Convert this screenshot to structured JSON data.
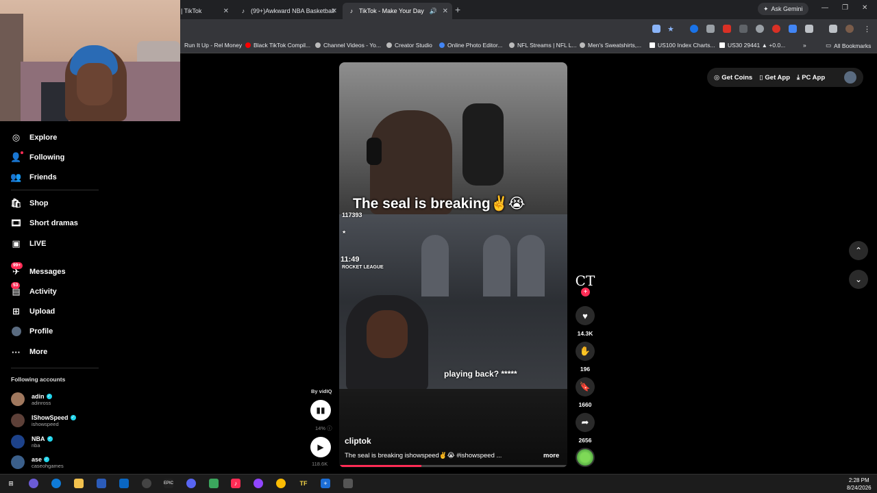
{
  "browser": {
    "tabs": [
      {
        "label": "| TikTok"
      },
      {
        "label": "(99+)Awkward NBA Basketball"
      },
      {
        "label": "TikTok - Make Your Day"
      }
    ],
    "ask_gemini": "Ask Gemini",
    "bookmarks": [
      "Run It Up - Rel Money",
      "Black TikTok Compil...",
      "Channel Videos - Yo...",
      "Creator Studio",
      "Online Photo Editor...",
      "NFL Streams | NFL L...",
      "Men's Sweatshirts,...",
      "US100 Index Charts...",
      "US30 29441 ▲ +0.0...",
      "All Bookmarks"
    ]
  },
  "sidebar": {
    "items": [
      {
        "label": "Explore"
      },
      {
        "label": "Following"
      },
      {
        "label": "Friends"
      },
      {
        "label": "Shop"
      },
      {
        "label": "Short dramas"
      },
      {
        "label": "LIVE"
      },
      {
        "label": "Messages",
        "badge": "99+"
      },
      {
        "label": "Activity",
        "badge": "53"
      },
      {
        "label": "Upload"
      },
      {
        "label": "Profile"
      },
      {
        "label": "More"
      }
    ],
    "following_header": "Following accounts",
    "accounts": [
      {
        "name": "adin",
        "handle": "adinross"
      },
      {
        "name": "IShowSpeed",
        "handle": "ishowspeed"
      },
      {
        "name": "NBA",
        "handle": "nba"
      },
      {
        "name": "ase",
        "handle": "caseohgames"
      }
    ]
  },
  "topright": {
    "get_coins": "Get Coins",
    "get_app": "Get App",
    "pc_app": "PC App"
  },
  "video": {
    "caption": "The seal is breaking✌️😭",
    "hud_score": "117393",
    "hud_time": "11:49",
    "hud_game": "ROCKET LEAGUE",
    "subtitle": "playing back? *****",
    "author": "cliptok",
    "description": "The seal is breaking ishowspeed✌️😭 #ishowspeed ...",
    "more": "more",
    "progress": 0.36
  },
  "actions": {
    "likes": "14.3K",
    "comments": "196",
    "saves": "1660",
    "shares": "2656",
    "creator_initials": "CT"
  },
  "vidiq": {
    "label": "By vidIQ",
    "percent": "14%",
    "views": "118.6K"
  },
  "taskbar": {
    "time": "2:28 PM",
    "date": "8/24/2026"
  }
}
